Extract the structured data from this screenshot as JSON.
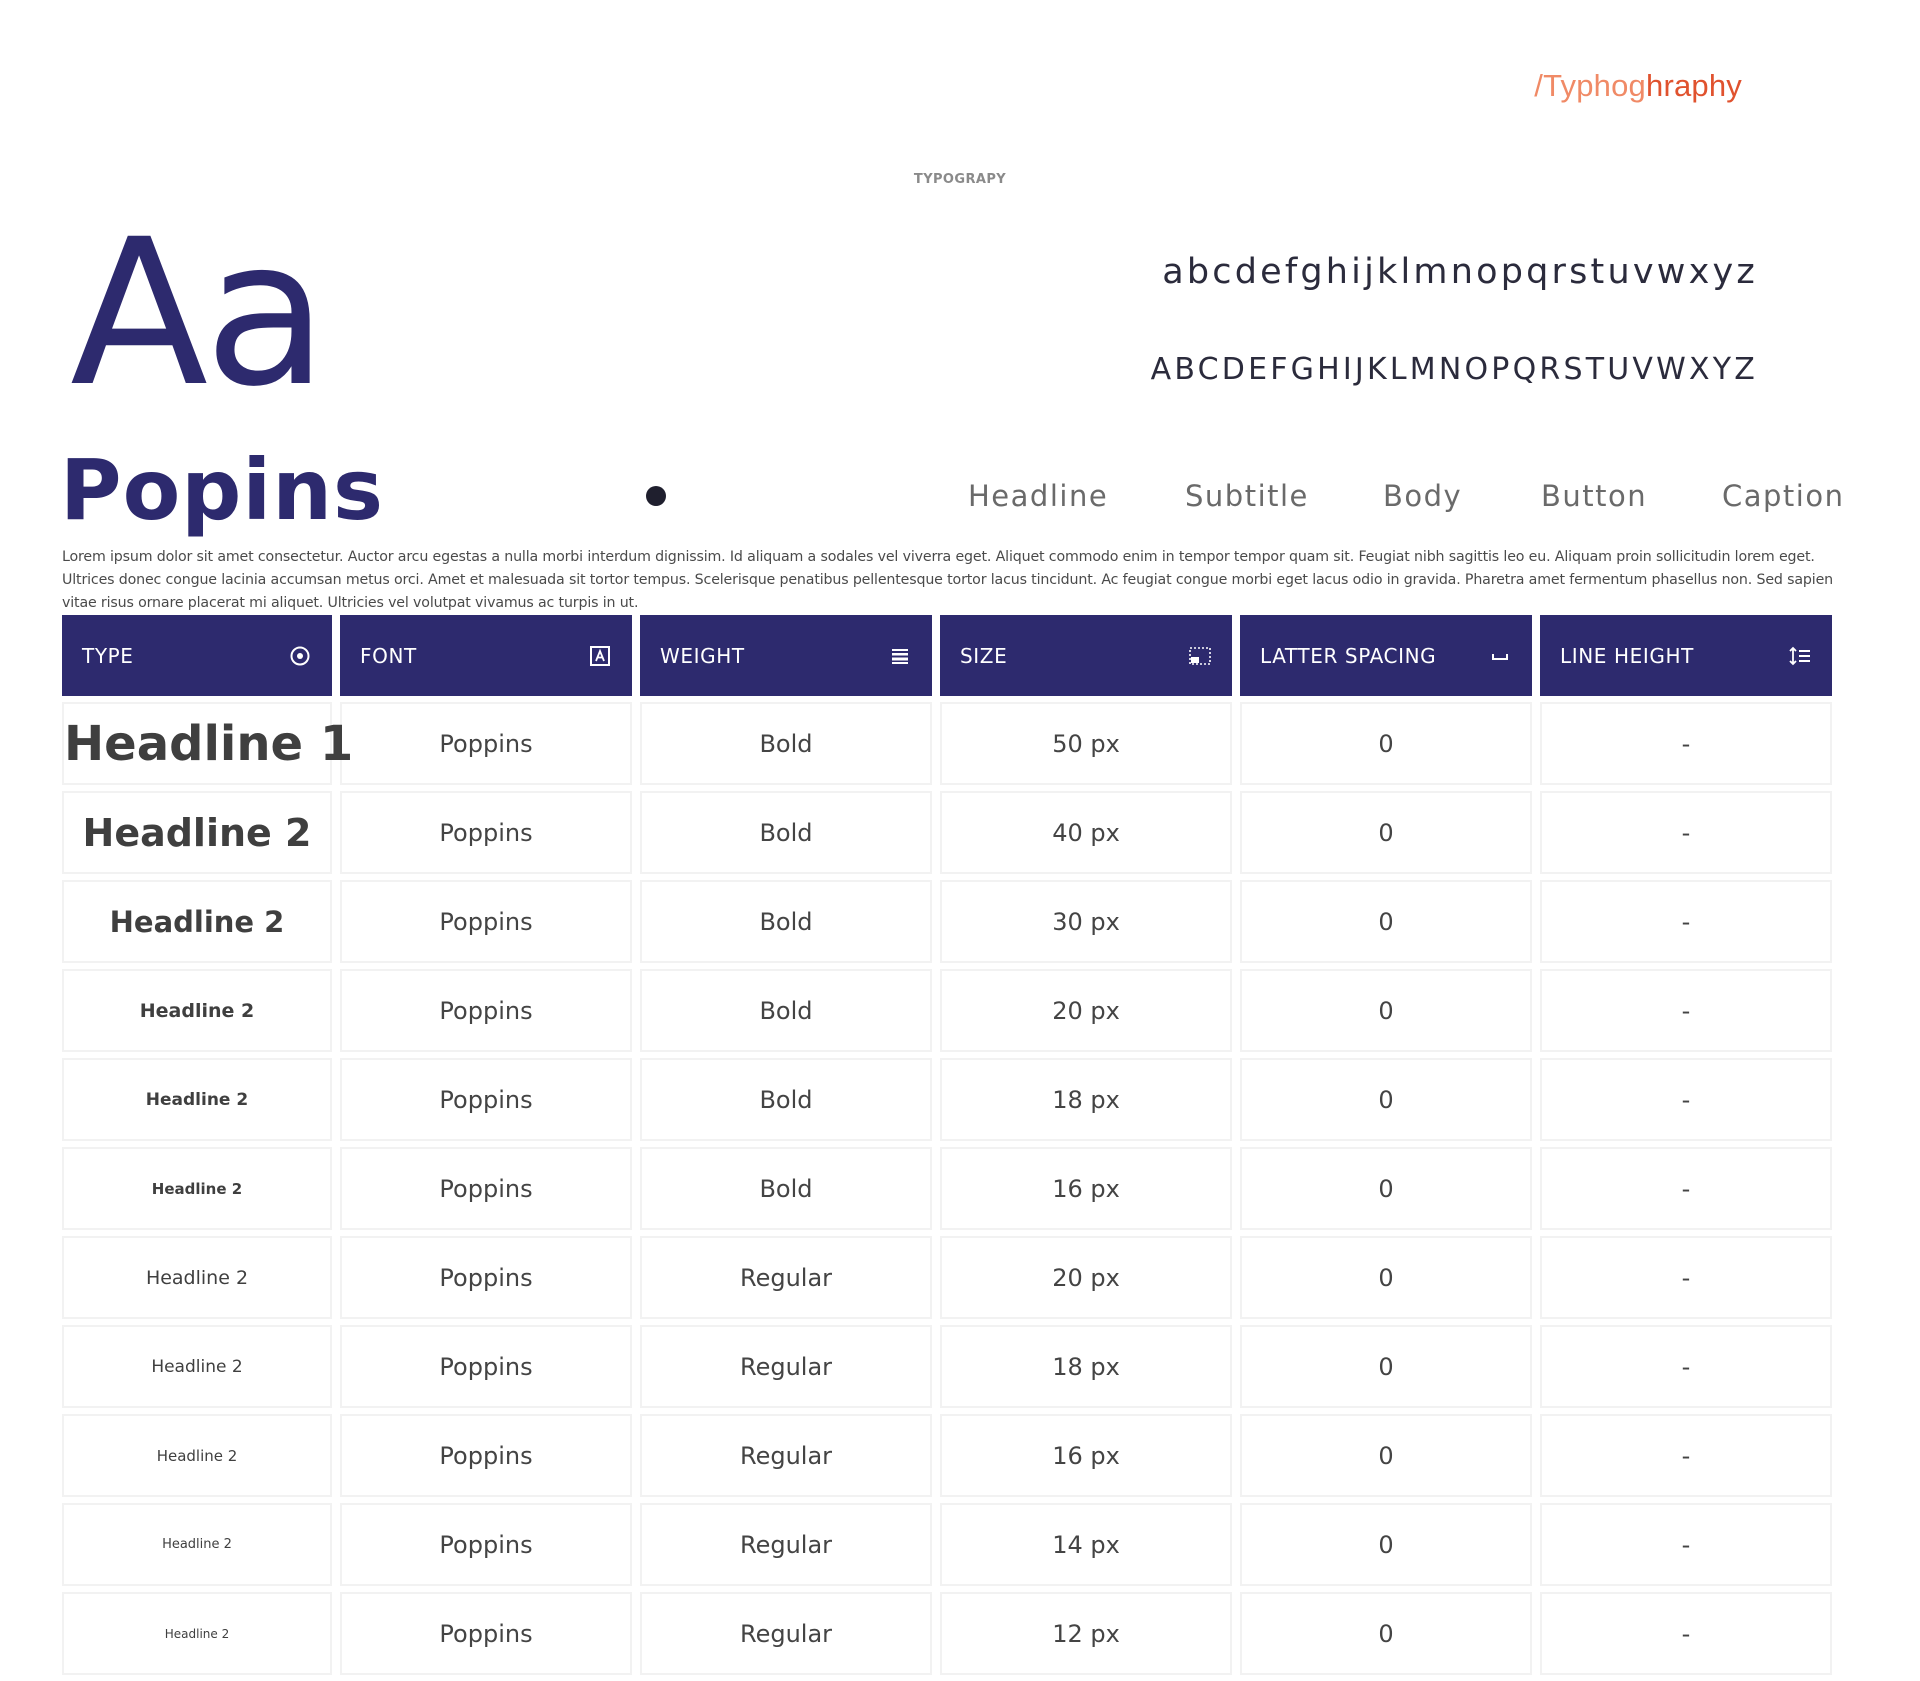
{
  "breadcrumb": {
    "prefix": "/Typhog",
    "tail": "hraphy"
  },
  "section_label": "TYPOGRAPY",
  "specimen": {
    "glyphs": "Aa",
    "lowercase": "abcdefghijklmnopqrstuvwxyz",
    "uppercase": "ABCDEFGHIJKLMNOPQRSTUVWXYZ",
    "font_name": "Popins"
  },
  "style_tabs": [
    "Headline",
    "Subtitle",
    "Body",
    "Button",
    "Caption"
  ],
  "lorem": "Lorem ipsum dolor sit amet consectetur. Auctor arcu egestas a nulla morbi interdum dignissim. Id aliquam a sodales vel viverra eget. Aliquet commodo enim in tempor tempor quam sit. Feugiat nibh sagittis leo eu. Aliquam proin sollicitudin lorem eget. Ultrices donec congue lacinia accumsan metus orci. Amet et malesuada sit tortor tempus. Scelerisque penatibus pellentesque tortor lacus tincidunt. Ac feugiat congue morbi eget lacus odio in gravida. Pharetra amet fermentum phasellus non. Sed sapien vitae risus ornare placerat mi aliquet. Ultricies vel volutpat vivamus ac turpis in ut.",
  "table": {
    "headers": [
      {
        "label": "TYPE",
        "icon": "target-icon"
      },
      {
        "label": "FONT",
        "icon": "font-box-icon"
      },
      {
        "label": "WEIGHT",
        "icon": "lines-icon"
      },
      {
        "label": "SIZE",
        "icon": "resize-icon"
      },
      {
        "label": "LATTER SPACING",
        "icon": "space-bar-icon"
      },
      {
        "label": "LINE HEIGHT",
        "icon": "line-height-icon"
      }
    ],
    "rows": [
      {
        "type": "Headline 1",
        "font": "Poppins",
        "weight": "Bold",
        "size": "50 px",
        "spacing": "0",
        "line_height": "-",
        "size_num": 50,
        "bold": true
      },
      {
        "type": "Headline 2",
        "font": "Poppins",
        "weight": "Bold",
        "size": "40 px",
        "spacing": "0",
        "line_height": "-",
        "size_num": 40,
        "bold": true
      },
      {
        "type": "Headline 2",
        "font": "Poppins",
        "weight": "Bold",
        "size": "30 px",
        "spacing": "0",
        "line_height": "-",
        "size_num": 30,
        "bold": true
      },
      {
        "type": "Headline 2",
        "font": "Poppins",
        "weight": "Bold",
        "size": "20 px",
        "spacing": "0",
        "line_height": "-",
        "size_num": 20,
        "bold": true
      },
      {
        "type": "Headline 2",
        "font": "Poppins",
        "weight": "Bold",
        "size": "18 px",
        "spacing": "0",
        "line_height": "-",
        "size_num": 18,
        "bold": true
      },
      {
        "type": "Headline 2",
        "font": "Poppins",
        "weight": "Bold",
        "size": "16 px",
        "spacing": "0",
        "line_height": "-",
        "size_num": 16,
        "bold": true
      },
      {
        "type": "Headline 2",
        "font": "Poppins",
        "weight": "Regular",
        "size": "20 px",
        "spacing": "0",
        "line_height": "-",
        "size_num": 20,
        "bold": false
      },
      {
        "type": "Headline 2",
        "font": "Poppins",
        "weight": "Regular",
        "size": "18 px",
        "spacing": "0",
        "line_height": "-",
        "size_num": 18,
        "bold": false
      },
      {
        "type": "Headline 2",
        "font": "Poppins",
        "weight": "Regular",
        "size": "16 px",
        "spacing": "0",
        "line_height": "-",
        "size_num": 16,
        "bold": false
      },
      {
        "type": "Headline 2",
        "font": "Poppins",
        "weight": "Regular",
        "size": "14 px",
        "spacing": "0",
        "line_height": "-",
        "size_num": 14,
        "bold": false
      },
      {
        "type": "Headline 2",
        "font": "Poppins",
        "weight": "Regular",
        "size": "12 px",
        "spacing": "0",
        "line_height": "-",
        "size_num": 12,
        "bold": false
      }
    ]
  },
  "colors": {
    "brand": "#2d2a6e",
    "accent": "#e0522e",
    "text": "#444444"
  }
}
